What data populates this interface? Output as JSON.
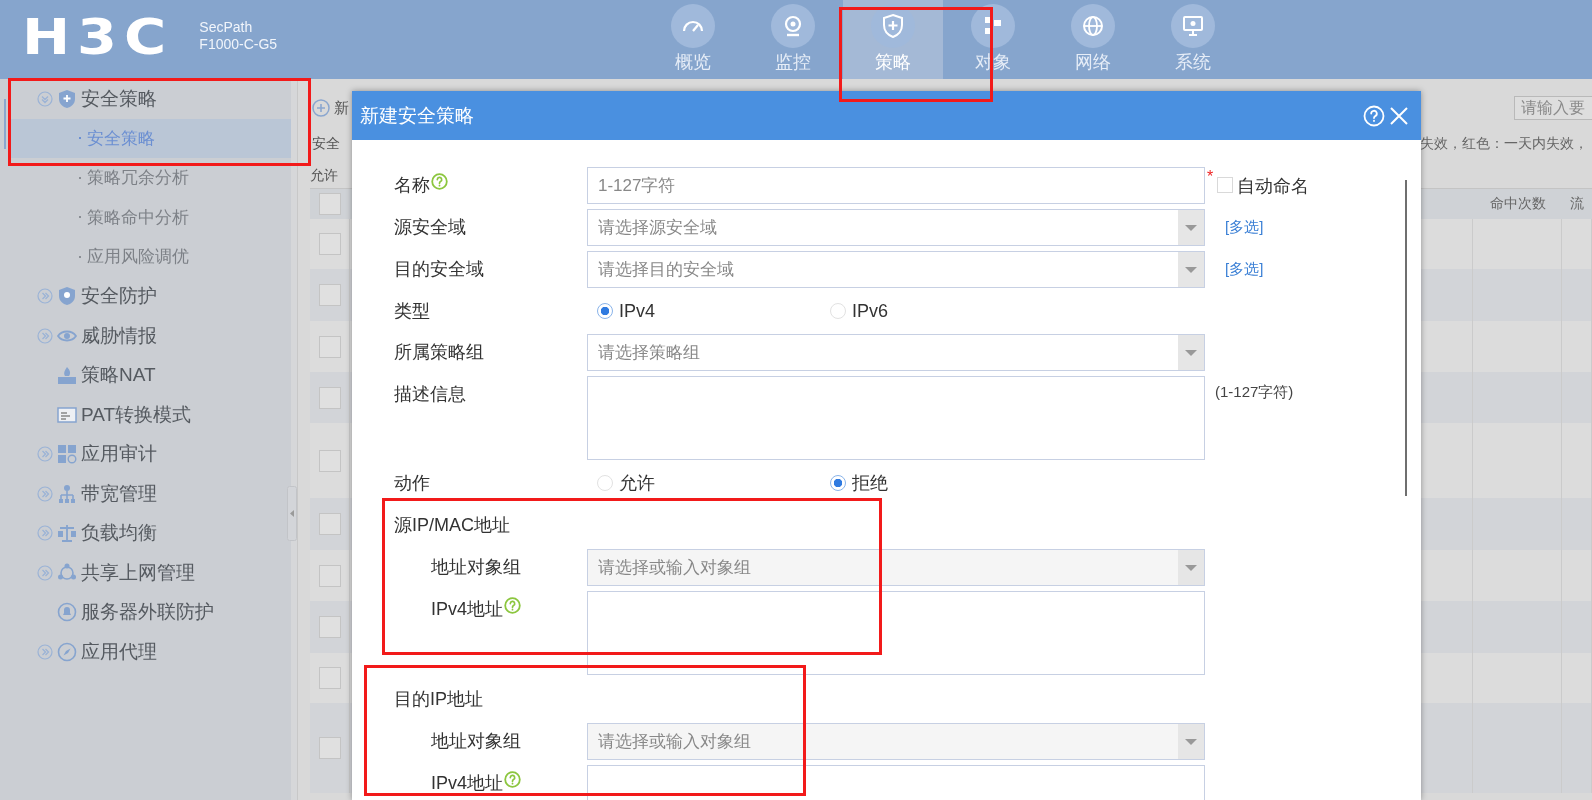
{
  "header": {
    "logo": "H3C",
    "product": "SecPath",
    "model": "F1000-C-G5",
    "tabs": [
      {
        "label": "概览",
        "selected": false
      },
      {
        "label": "监控",
        "selected": false
      },
      {
        "label": "策略",
        "selected": true
      },
      {
        "label": "对象",
        "selected": false
      },
      {
        "label": "网络",
        "selected": false
      },
      {
        "label": "系统",
        "selected": false
      }
    ]
  },
  "sidebar": {
    "items": [
      {
        "label": "安全策略",
        "expanded": true,
        "children": [
          {
            "label": "安全策略",
            "selected": true
          },
          {
            "label": "策略冗余分析",
            "selected": false
          },
          {
            "label": "策略命中分析",
            "selected": false
          },
          {
            "label": "应用风险调优",
            "selected": false
          }
        ]
      },
      {
        "label": "安全防护",
        "expanded": false
      },
      {
        "label": "威胁情报",
        "expanded": false
      },
      {
        "label": "策略NAT"
      },
      {
        "label": "PAT转换模式"
      },
      {
        "label": "应用审计",
        "expanded": false
      },
      {
        "label": "带宽管理",
        "expanded": false
      },
      {
        "label": "负载均衡",
        "expanded": false
      },
      {
        "label": "共享上网管理",
        "expanded": false
      },
      {
        "label": "服务器外联防护"
      },
      {
        "label": "应用代理",
        "expanded": false
      }
    ]
  },
  "page": {
    "new_button": "新",
    "search": {
      "placeholder": "请输入要"
    },
    "info_left": "安全",
    "info_right": "失效，红色：一天内失效，",
    "filter_label": "允许",
    "table": {
      "header_checked": false,
      "columns": [
        "命中次数",
        "流"
      ],
      "rows": [
        {
          "checked": false
        },
        {
          "checked": false
        },
        {
          "checked": false
        },
        {
          "checked": false
        },
        {
          "checked": false
        },
        {
          "checked": false
        },
        {
          "checked": false
        },
        {
          "checked": false
        },
        {
          "checked": false
        },
        {
          "checked": false
        }
      ]
    }
  },
  "dialog": {
    "title": "新建安全策略",
    "fields": [
      {
        "kind": "text",
        "label": "名称",
        "help": true,
        "placeholder": "1-127字符",
        "required_mark": "*",
        "checkbox": {
          "label": "自动命名",
          "checked": false
        }
      },
      {
        "kind": "select",
        "label": "源安全域",
        "placeholder": "请选择源安全域",
        "link": "[多选]"
      },
      {
        "kind": "select",
        "label": "目的安全域",
        "placeholder": "请选择目的安全域",
        "link": "[多选]"
      },
      {
        "kind": "radio",
        "label": "类型",
        "options": [
          {
            "label": "IPv4",
            "selected": true
          },
          {
            "label": "IPv6",
            "selected": false
          }
        ]
      },
      {
        "kind": "select",
        "label": "所属策略组",
        "placeholder": "请选择策略组"
      },
      {
        "kind": "textarea",
        "label": "描述信息",
        "note": "(1-127字符)"
      },
      {
        "kind": "radio",
        "label": "动作",
        "options": [
          {
            "label": "允许",
            "selected": false
          },
          {
            "label": "拒绝",
            "selected": true
          }
        ]
      },
      {
        "kind": "section",
        "label": "源IP/MAC地址",
        "children": [
          {
            "kind": "combo",
            "label": "地址对象组",
            "placeholder": "请选择或输入对象组"
          },
          {
            "kind": "textarea",
            "label": "IPv4地址",
            "help": true
          }
        ]
      },
      {
        "kind": "section",
        "label": "目的IP地址",
        "children": [
          {
            "kind": "combo",
            "label": "地址对象组",
            "placeholder": "请选择或输入对象组"
          },
          {
            "kind": "textarea",
            "label": "IPv4地址",
            "help": true
          }
        ]
      }
    ]
  }
}
